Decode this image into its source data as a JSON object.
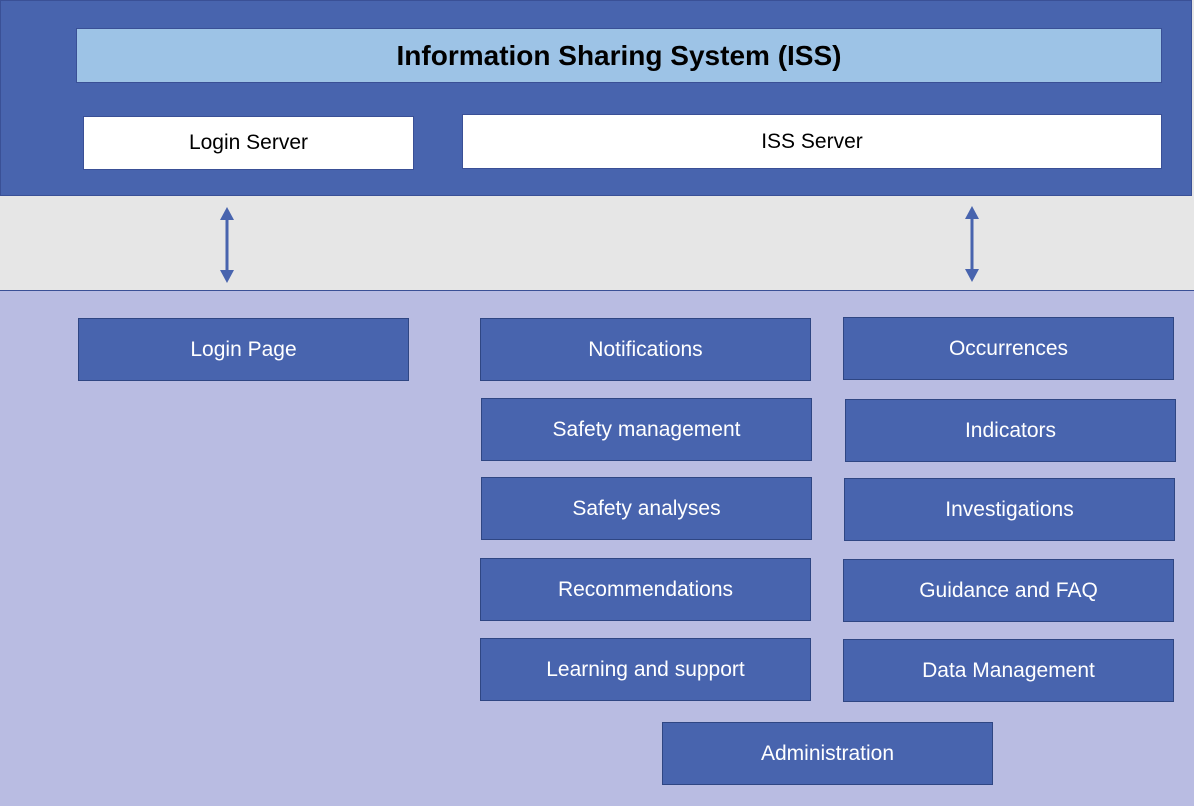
{
  "diagram": {
    "title": "Information Sharing System (ISS)",
    "servers": {
      "login": "Login Server",
      "iss": "ISS Server"
    },
    "login_page": "Login Page",
    "modules": {
      "notifications": "Notifications",
      "occurrences": "Occurrences",
      "safety_management": "Safety management",
      "indicators": "Indicators",
      "safety_analyses": "Safety analyses",
      "investigations": "Investigations",
      "recommendations": "Recommendations",
      "guidance_faq": "Guidance and FAQ",
      "learning_support": "Learning and support",
      "data_management": "Data Management",
      "administration": "Administration"
    },
    "colors": {
      "top_panel": "#4864ae",
      "title_bar": "#9dc3e6",
      "module_fill": "#4864ae",
      "bottom_panel": "#b9bce2",
      "middle_band": "#e6e6e6"
    }
  }
}
